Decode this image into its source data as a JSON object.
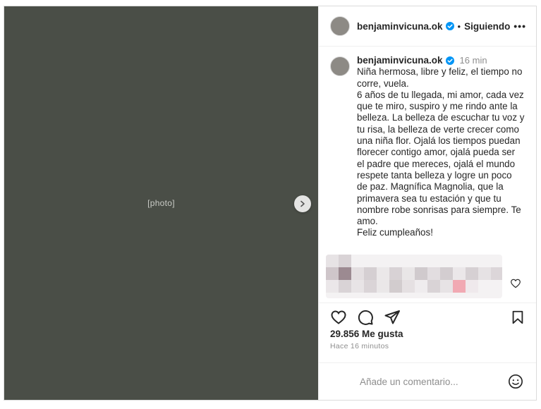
{
  "post": {
    "username": "benjaminvicuna.ok",
    "follow_status": "Siguiendo",
    "separator": "•",
    "more_label": "•••",
    "photo_alt": "[photo]"
  },
  "caption": {
    "username": "benjaminvicuna.ok",
    "time": "16 min",
    "text": "Niña hermosa, libre y feliz, el tiempo no corre, vuela.\n6 años de tu llegada, mi amor, cada vez que te miro, suspiro y me rindo ante la belleza. La belleza de escuchar tu voz y tu risa, la belleza de verte crecer como una niña flor. Ojalá los tiempos puedan florecer contigo amor, ojalá pueda ser el padre que mereces, ojalá el mundo respete tanta belleza y logre un poco de paz. Magnífica Magnolia, que la primavera sea tu estación y que tu nombre robe sonrisas para siempre. Te amo.\nFeliz cumpleaños!"
  },
  "stats": {
    "likes": "29.856 Me gusta",
    "posted_ago": "Hace 16 minutos"
  },
  "comment_box": {
    "placeholder": "Añade un comentario..."
  },
  "icons": {
    "verified": "verified-badge-icon",
    "carousel_next": "chevron-right-icon",
    "like": "heart-icon",
    "comment": "comment-icon",
    "share": "paper-plane-icon",
    "save": "bookmark-icon",
    "emoji": "smiley-icon"
  },
  "colors": {
    "verified_blue": "#0095f6",
    "text": "#262626",
    "muted": "#8e8e8e",
    "border": "#dbdbdb"
  }
}
